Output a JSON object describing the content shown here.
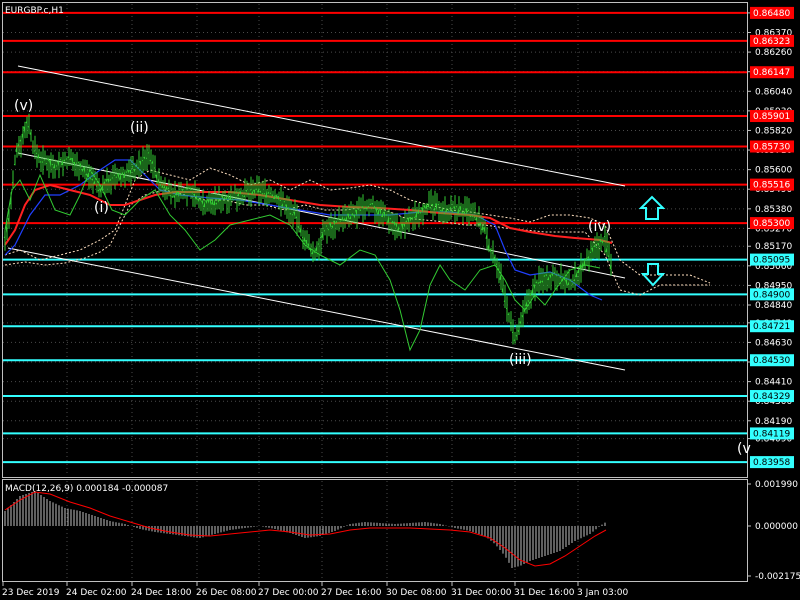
{
  "chart_title": "EURGBP.c,H1",
  "macd_title": "MACD(12,26,9) 0.000184 -0.000087",
  "price_axis": {
    "ticks": [
      "0.86480",
      "0.86370",
      "0.86260",
      "0.86150",
      "0.86040",
      "0.85930",
      "0.85820",
      "0.85710",
      "0.85600",
      "0.85490",
      "0.85380",
      "0.85270",
      "0.85170",
      "0.85060",
      "0.84950",
      "0.84840",
      "0.84740",
      "0.84630",
      "0.84520",
      "0.84410",
      "0.84300",
      "0.84190",
      "0.84090"
    ],
    "range": [
      0.8388,
      0.8653
    ]
  },
  "red_levels": [
    {
      "price": 0.8648,
      "label": "0.86480"
    },
    {
      "price": 0.86323,
      "label": "0.86323"
    },
    {
      "price": 0.86147,
      "label": "0.86147"
    },
    {
      "price": 0.85901,
      "label": "0.85901"
    },
    {
      "price": 0.8573,
      "label": "0.85730"
    },
    {
      "price": 0.85516,
      "label": "0.85516"
    },
    {
      "price": 0.853,
      "label": "0.85300"
    }
  ],
  "cyan_levels": [
    {
      "price": 0.85095,
      "label": "0.85095"
    },
    {
      "price": 0.849,
      "label": "0.84900"
    },
    {
      "price": 0.84721,
      "label": "0.84721"
    },
    {
      "price": 0.8453,
      "label": "0.84530"
    },
    {
      "price": 0.84329,
      "label": "0.84329"
    },
    {
      "price": 0.84119,
      "label": "0.84119"
    },
    {
      "price": 0.83958,
      "label": "0.83958"
    }
  ],
  "macd_axis": [
    "0.001990",
    "0.000000",
    "-0.002175"
  ],
  "time_labels": [
    "23 Dec 2019",
    "24 Dec 02:00",
    "24 Dec 18:00",
    "26 Dec 08:00",
    "27 Dec 00:00",
    "27 Dec 16:00",
    "30 Dec 08:00",
    "31 Dec 00:00",
    "31 Dec 16:00",
    "3 Jan 03:00"
  ],
  "wave_labels": [
    "(v)",
    "(ii)",
    "(i)",
    "(iii)",
    "(iv)",
    "(v"
  ],
  "colors": {
    "background": "#000000",
    "price": "#33cc33",
    "red_level": "#ff0000",
    "cyan_level": "#33ffff",
    "ma_red": "#ff2020",
    "ma_blue": "#2040ff",
    "ichimoku": "#ffe0c0",
    "channel": "#ffffff",
    "macd_hist": "#c0c0c0",
    "macd_signal": "#ff0000"
  },
  "icons": [
    "arrow-up-outline-icon",
    "arrow-down-outline-icon"
  ]
}
